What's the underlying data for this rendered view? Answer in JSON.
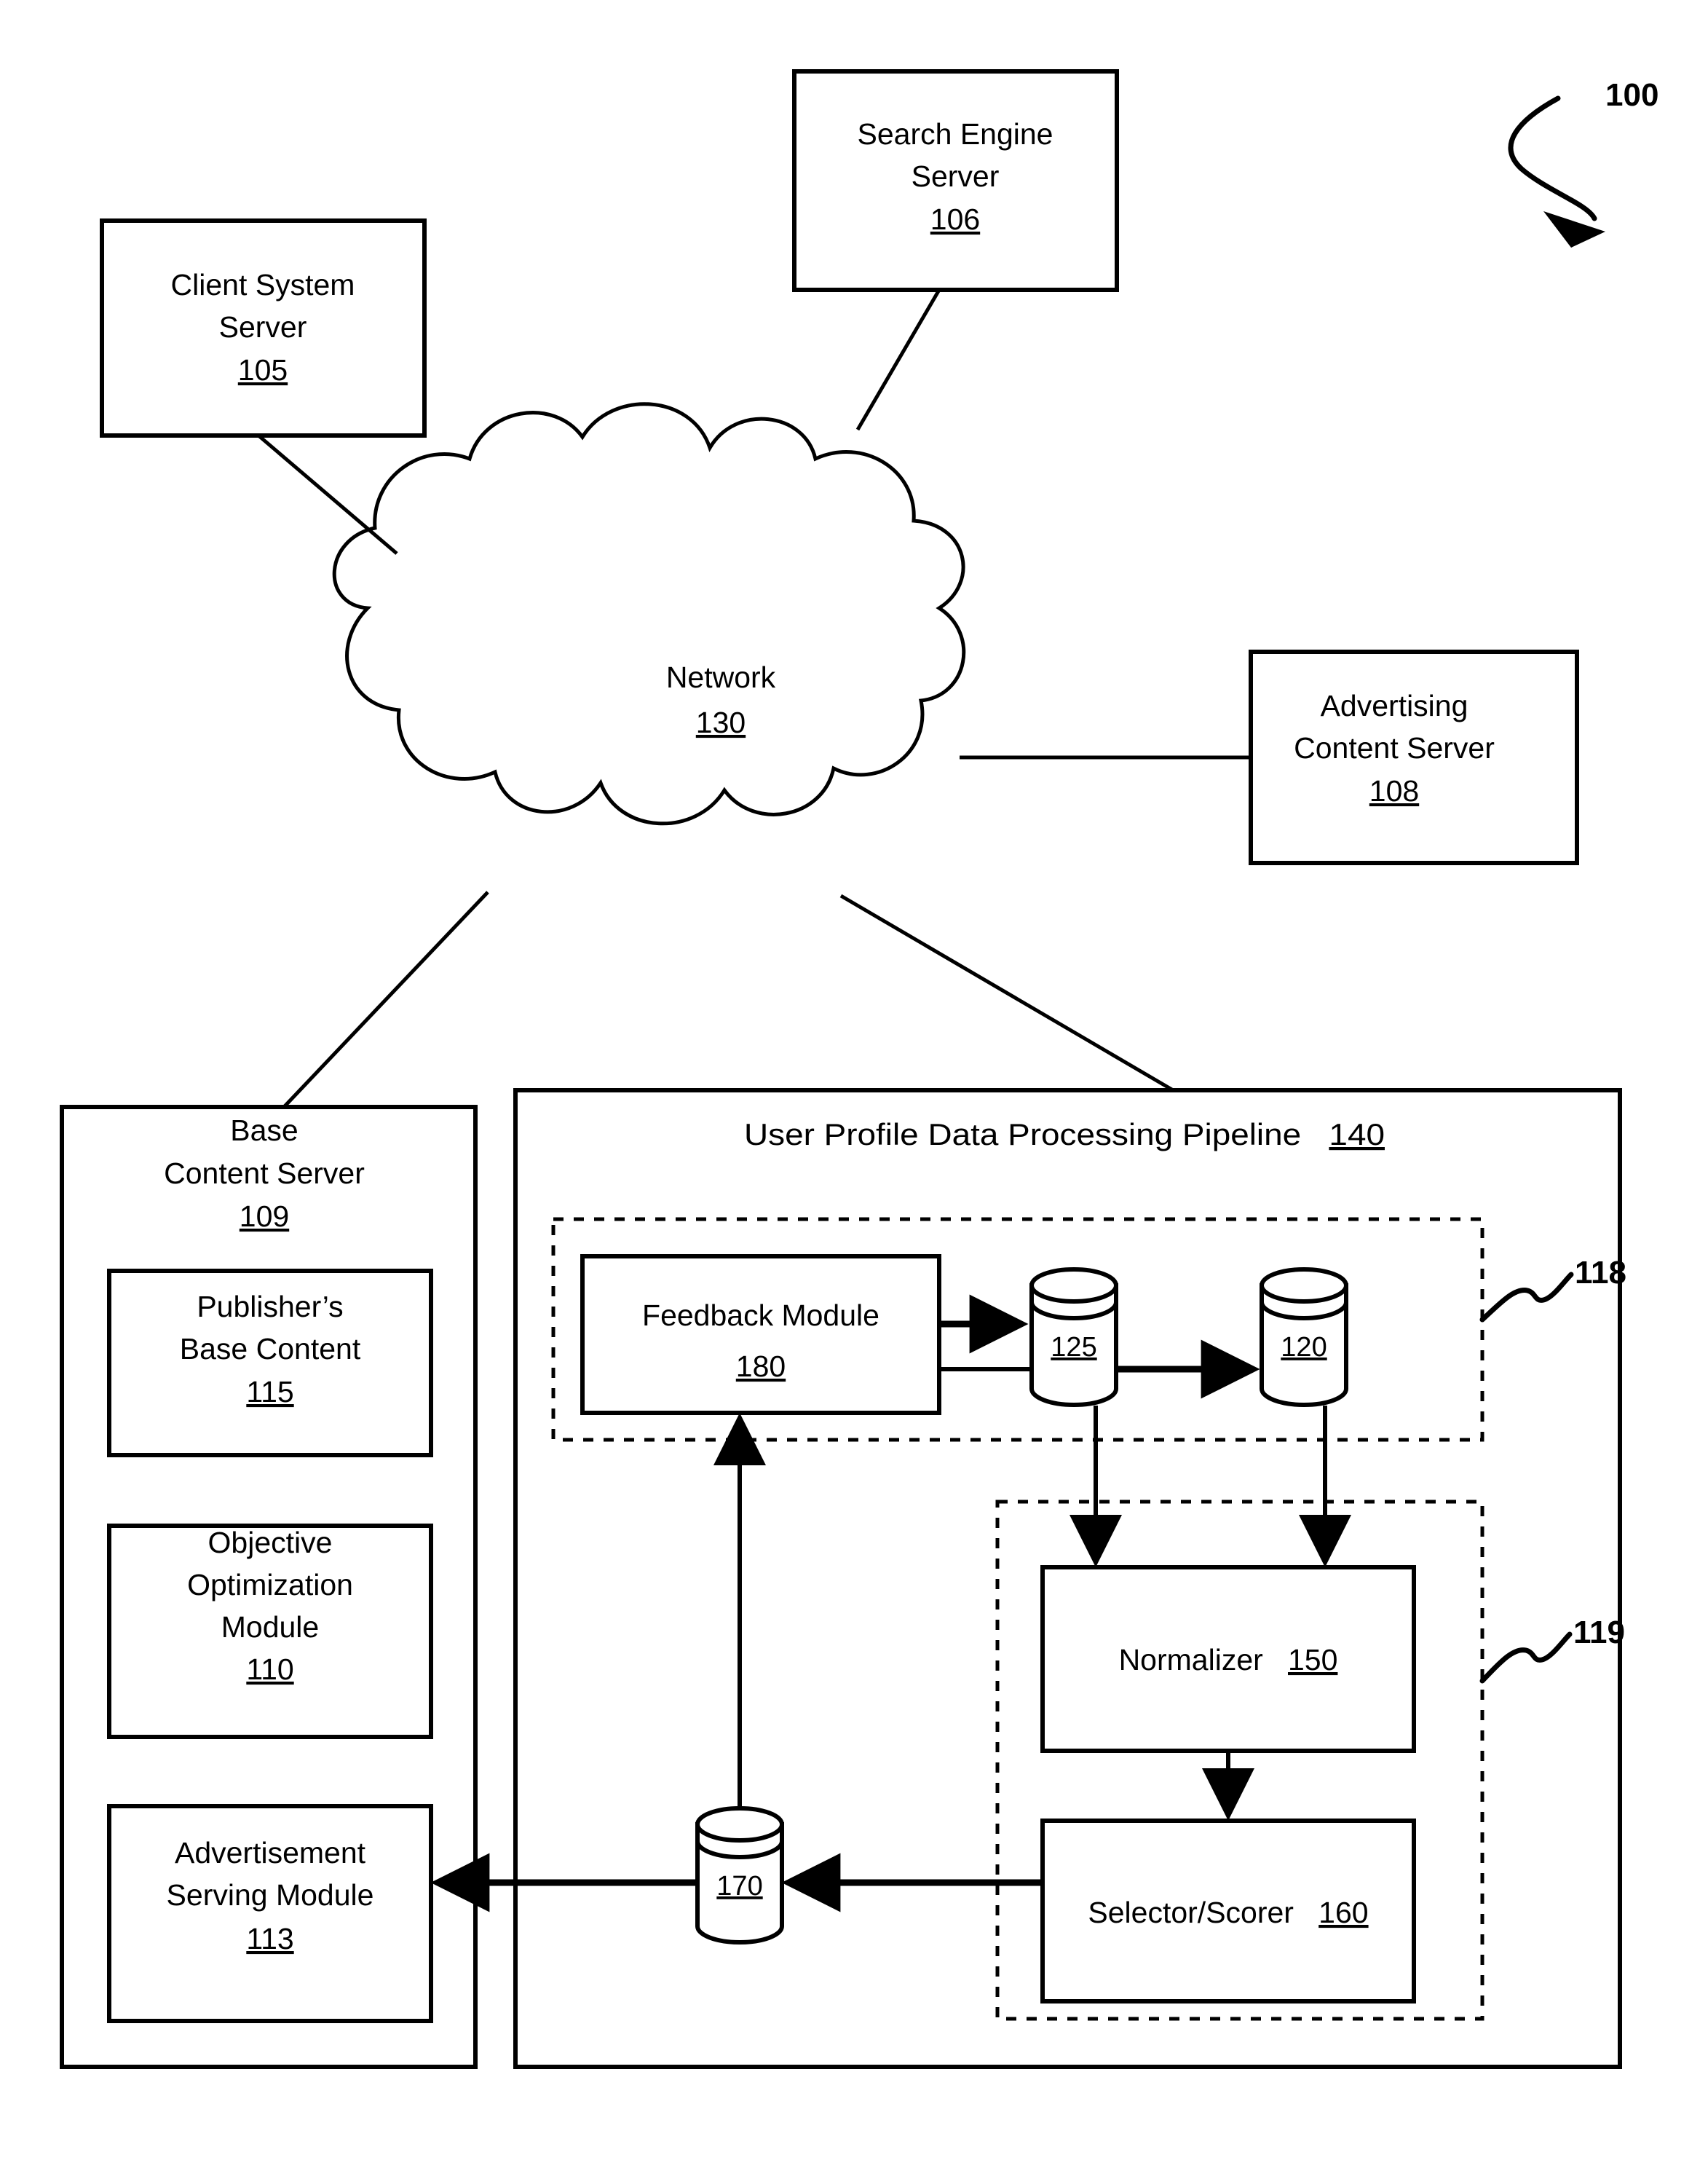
{
  "figure": {
    "number_label": "100",
    "title": "System architecture diagram"
  },
  "nodes": {
    "client_system_server": {
      "line1": "Client System",
      "line2": "Server",
      "ref": "105"
    },
    "search_engine_server": {
      "line1": "Search Engine",
      "line2": "Server",
      "ref": "106"
    },
    "network": {
      "line1": "Network",
      "ref": "130"
    },
    "advertising_content_server": {
      "line1": "Advertising",
      "line2": "Content Server",
      "ref": "108"
    },
    "base_content_server": {
      "line1": "Base",
      "line2": "Content Server",
      "ref": "109"
    },
    "publishers_base_content": {
      "line1": "Publisher’s",
      "line2": "Base Content",
      "ref": "115"
    },
    "objective_optimization_module": {
      "line1": "Objective",
      "line2": "Optimization",
      "line3": "Module",
      "ref": "110"
    },
    "advertisement_serving_module": {
      "line1": "Advertisement",
      "line2": "Serving Module",
      "ref": "113"
    },
    "pipeline": {
      "title": "User Profile Data Processing Pipeline",
      "ref": "140"
    },
    "feedback_module": {
      "line1": "Feedback Module",
      "ref": "180"
    },
    "normalizer": {
      "line1": "Normalizer",
      "ref": "150"
    },
    "selector_scorer": {
      "line1": "Selector/Scorer",
      "ref": "160"
    },
    "datastore_125": {
      "ref": "125"
    },
    "datastore_120": {
      "ref": "120"
    },
    "datastore_170": {
      "ref": "170"
    }
  },
  "group_callouts": {
    "group_118": "118",
    "group_119": "119"
  }
}
